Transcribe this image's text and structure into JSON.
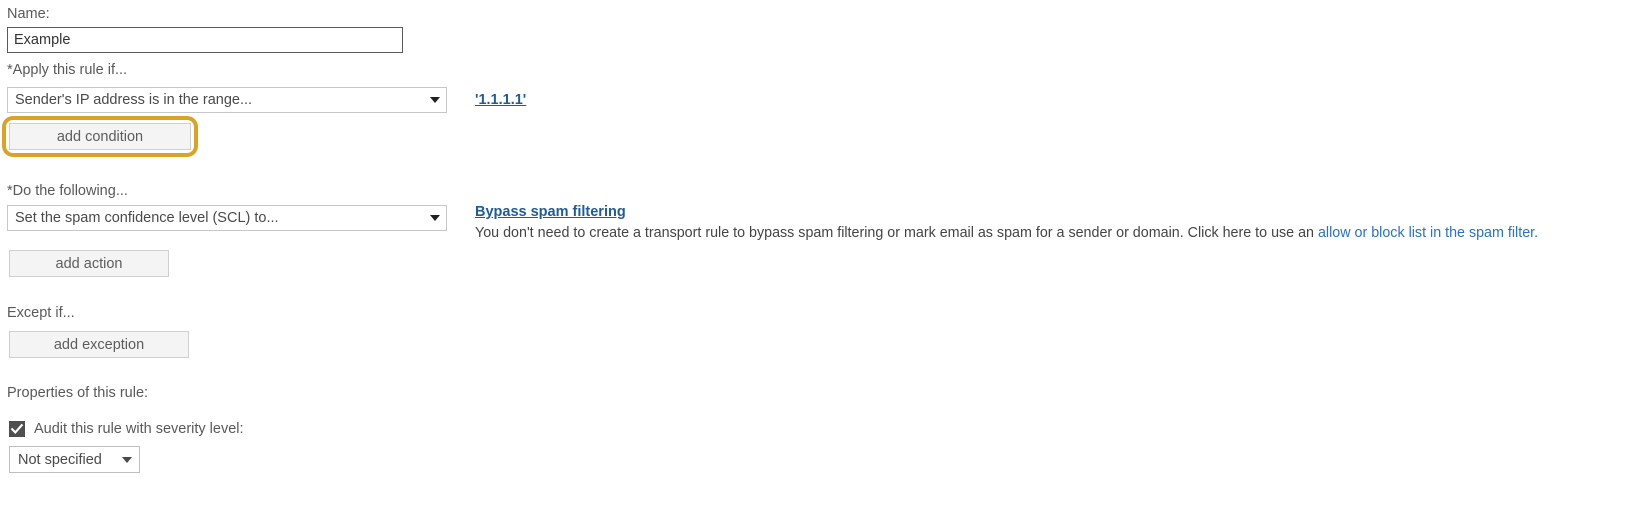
{
  "form": {
    "name": {
      "label": "Name:",
      "value": "Example",
      "placeholder": ""
    },
    "condition": {
      "label": "*Apply this rule if...",
      "selected": "Sender's IP address is in the range...",
      "value_link": "'1.1.1.1'",
      "add_button": "add condition"
    },
    "action": {
      "label": "*Do the following...",
      "selected": "Set the spam confidence level (SCL) to...",
      "add_button": "add action",
      "info_link": "Bypass spam filtering",
      "info_text_before": "You don't need to create a transport rule to bypass spam filtering or mark email as spam for a sender or domain. Click here to use an ",
      "info_text_link": "allow or block list in the spam filter."
    },
    "exception": {
      "label": "Except if...",
      "add_button": "add exception"
    },
    "properties": {
      "label": "Properties of this rule:",
      "audit_checkbox_label": "Audit this rule with severity level:",
      "audit_checked": true,
      "severity_selected": "Not specified"
    }
  },
  "colors": {
    "focus_ring": "#d9a326",
    "link": "#1f5c99",
    "inline_link": "#2a72c4",
    "label_text": "#595959",
    "button_face": "#f4f4f4"
  },
  "icons": {
    "dropdown": "chevron-down-icon",
    "checkmark": "check-icon"
  }
}
